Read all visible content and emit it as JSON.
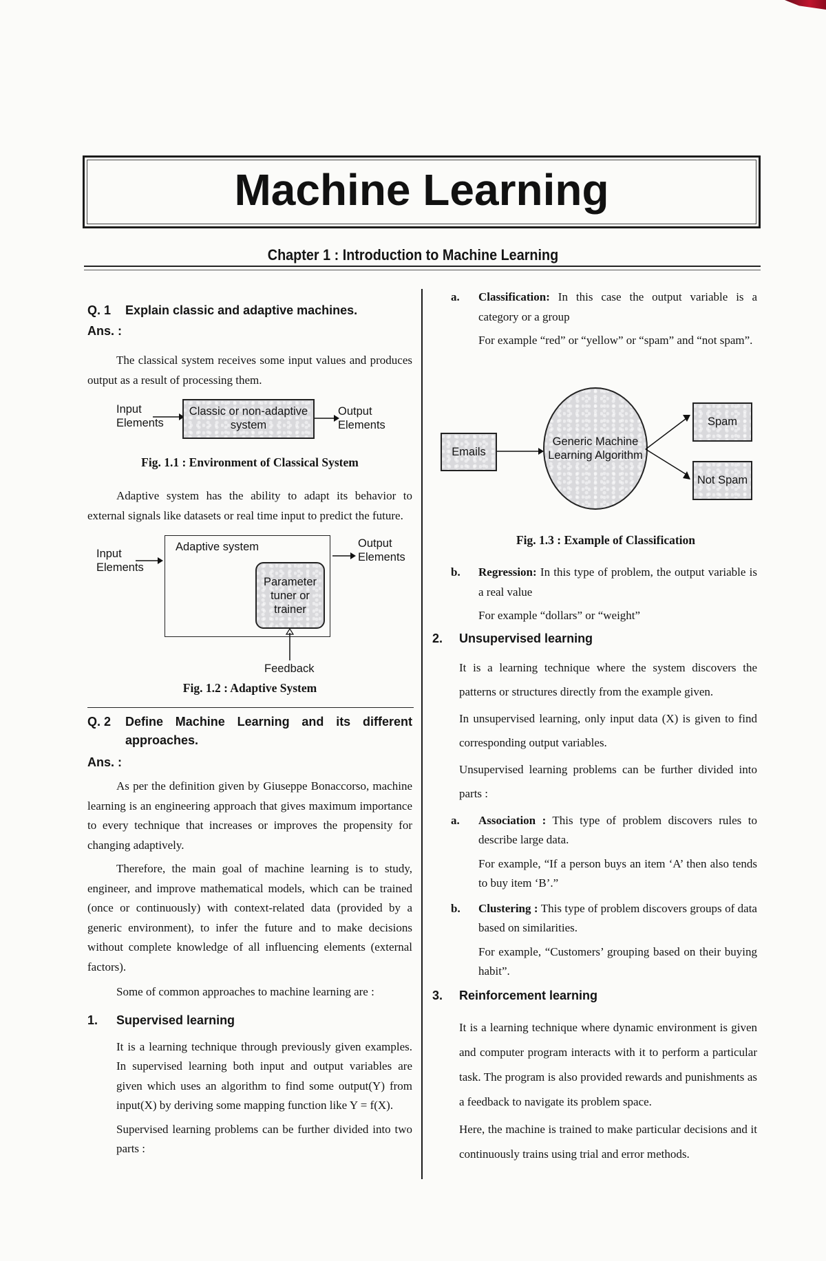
{
  "book": {
    "title": "Machine Learning",
    "chapter": "Chapter 1 : Introduction to Machine Learning"
  },
  "q1": {
    "number": "Q. 1",
    "question": "Explain classic and adaptive machines.",
    "ans_label": "Ans. :",
    "para1": "The classical system receives some input values and produces output as a result of processing them.",
    "fig1": {
      "input": [
        "Input",
        "Elements"
      ],
      "box": [
        "Classic or non-adaptive",
        "system"
      ],
      "output": [
        "Output",
        "Elements"
      ],
      "caption": "Fig. 1.1 : Environment of Classical System"
    },
    "para2": "Adaptive system has the ability to adapt its behavior to external signals like datasets or real time input to predict the future.",
    "fig2": {
      "input": [
        "Input",
        "Elements"
      ],
      "outer_box": "Adaptive system",
      "inner_box": [
        "Parameter",
        "tuner or",
        "trainer"
      ],
      "output": [
        "Output",
        "Elements"
      ],
      "feedback": "Feedback",
      "caption": "Fig. 1.2 : Adaptive System"
    }
  },
  "q2": {
    "number": "Q. 2",
    "question_line1": "Define Machine Learning and its different",
    "question_line2": "approaches.",
    "ans_label": "Ans. :",
    "para1": "As per the definition given by Giuseppe Bonaccorso, machine learning is an engineering approach that gives maximum importance to every technique that increases or improves the propensity for changing adaptively.",
    "para2": "Therefore, the main goal of machine learning is to study, engineer, and improve mathematical models, which can be trained (once or continuously) with context-related data (provided by a generic environment), to infer the future and to make decisions without complete knowledge of all influencing elements (external factors).",
    "para3": "Some of common approaches to machine learning are :"
  },
  "sections": {
    "supervised": {
      "number": "1.",
      "title": "Supervised learning",
      "para1": "It is a learning technique through previously given examples. In supervised learning both input and output variables are given which uses an algorithm to find some output(Y) from input(X) by deriving some mapping function like Y = f(X).",
      "para2": "Supervised learning problems can be further divided into two parts :",
      "classification": {
        "letter": "a.",
        "term": "Classification:",
        "text": " In this case the output variable is a category or a group",
        "example": "For example “red” or “yellow” or “spam” and “not spam”."
      },
      "fig3": {
        "input": "Emails",
        "algorithm": [
          "Generic Machine",
          "Learning Algorithm"
        ],
        "out1": "Spam",
        "out2": "Not Spam",
        "caption": "Fig. 1.3 : Example of Classification"
      },
      "regression": {
        "letter": "b.",
        "term": "Regression:",
        "text": " In this type of problem, the output variable is a real value",
        "example": "For example “dollars” or “weight”"
      }
    },
    "unsupervised": {
      "number": "2.",
      "title": "Unsupervised learning",
      "para1": "It is a learning technique where the system discovers the patterns or structures directly from the example given.",
      "para2": "In unsupervised learning, only input data (X) is given to find corresponding output variables.",
      "para3": "Unsupervised learning problems can be further divided into parts :",
      "association": {
        "letter": "a.",
        "term": "Association :",
        "text": " This type of problem discovers rules to describe large data.",
        "example": "For example, “If a person buys an item ‘A’ then also tends to buy item ‘B’.”"
      },
      "clustering": {
        "letter": "b.",
        "term": "Clustering :",
        "text": " This type of problem discovers groups of data based on similarities.",
        "example": "For example, “Customers’ grouping based on their buying habit”."
      }
    },
    "reinforcement": {
      "number": "3.",
      "title": "Reinforcement learning",
      "para1": "It is a learning technique where dynamic environment is given and computer program interacts with it to perform a particular task. The program is also provided rewards and punishments as a feedback to navigate its problem space.",
      "para2": "Here, the machine is trained to make particular decisions and it continuously trains using trial and error methods."
    }
  }
}
